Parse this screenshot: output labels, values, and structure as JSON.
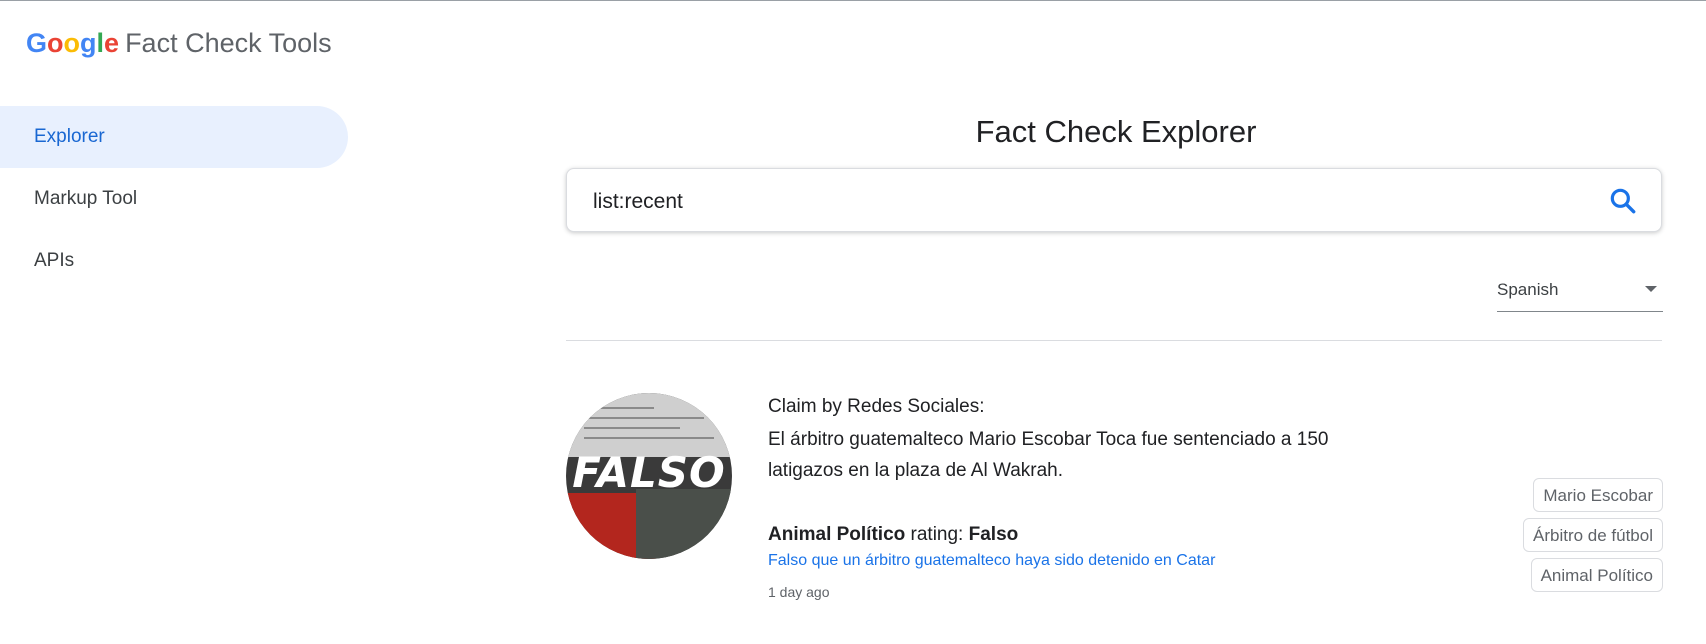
{
  "brand": {
    "google_letters": [
      {
        "ch": "G",
        "color": "#4285F4"
      },
      {
        "ch": "o",
        "color": "#EA4335"
      },
      {
        "ch": "o",
        "color": "#FBBC05"
      },
      {
        "ch": "g",
        "color": "#4285F4"
      },
      {
        "ch": "l",
        "color": "#34A853"
      },
      {
        "ch": "e",
        "color": "#EA4335"
      }
    ],
    "product": "Fact Check Tools"
  },
  "nav": {
    "items": [
      {
        "label": "Explorer",
        "active": true
      },
      {
        "label": "Markup Tool",
        "active": false
      },
      {
        "label": "APIs",
        "active": false
      }
    ]
  },
  "main": {
    "title": "Fact Check Explorer",
    "search": {
      "value": "list:recent",
      "icon": "search-icon"
    },
    "language": {
      "selected": "Spanish"
    }
  },
  "result": {
    "image_overlay_text": "FALSO",
    "claim_by": "Claim by Redes Sociales:",
    "claim_text": "El árbitro guatemalteco Mario Escobar Toca fue sentenciado a 150 latigazos en la plaza de Al Wakrah.",
    "publisher": "Animal Político",
    "rating_label": "rating:",
    "rating_value": "Falso",
    "article_title": "Falso que un árbitro guatemalteco haya sido detenido en Catar",
    "time_ago": "1 day ago",
    "tags": [
      "Mario Escobar",
      "Árbitro de fútbol",
      "Animal Político"
    ]
  },
  "colors": {
    "accent": "#1a73e8",
    "nav_active_bg": "#e8f0fe"
  }
}
